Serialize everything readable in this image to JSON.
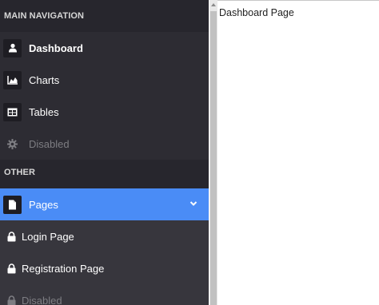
{
  "sidebar": {
    "main_nav_title": "MAIN NAVIGATION",
    "main_items": [
      {
        "label": "Dashboard",
        "icon": "user-icon"
      },
      {
        "label": "Charts",
        "icon": "area-chart-icon"
      },
      {
        "label": "Tables",
        "icon": "table-icon"
      },
      {
        "label": "Disabled",
        "icon": "gear-icon"
      }
    ],
    "other_title": "OTHER",
    "pages_item": {
      "label": "Pages",
      "icon": "file-icon"
    },
    "sub_items": [
      {
        "label": "Login Page",
        "icon": "lock-icon"
      },
      {
        "label": "Registration Page",
        "icon": "lock-icon"
      },
      {
        "label": "Disabled",
        "icon": "lock-icon"
      }
    ]
  },
  "main": {
    "page_text": "Dashboard Page"
  },
  "colors": {
    "sidebar_bg": "#2d2c33",
    "accent": "#4a8cf6",
    "disabled_text": "#7d7d82"
  }
}
